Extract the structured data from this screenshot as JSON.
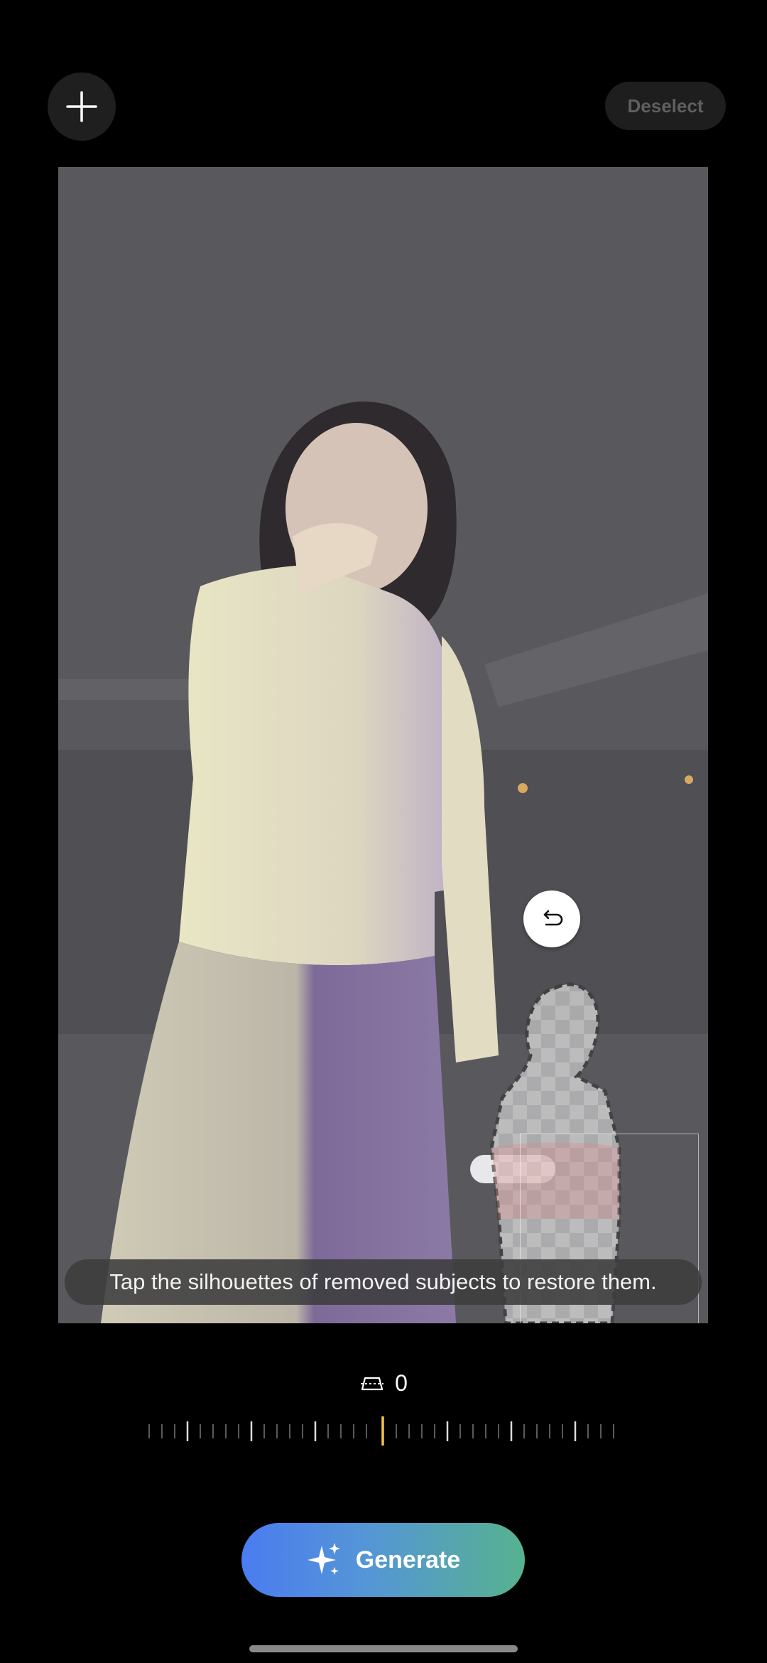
{
  "top_bar": {
    "add_icon": "plus-icon",
    "deselect_label": "Deselect"
  },
  "editor": {
    "undo_icon": "undo-arrow-icon",
    "hint_text": "Tap the silhouettes of removed subjects to restore them."
  },
  "angle_control": {
    "icon": "perspective-icon",
    "value": "0",
    "accent_color": "#f5c542"
  },
  "generate": {
    "icon": "sparkle-icon",
    "label": "Generate",
    "gradient": [
      "#4a7cf0",
      "#56b28e"
    ]
  }
}
